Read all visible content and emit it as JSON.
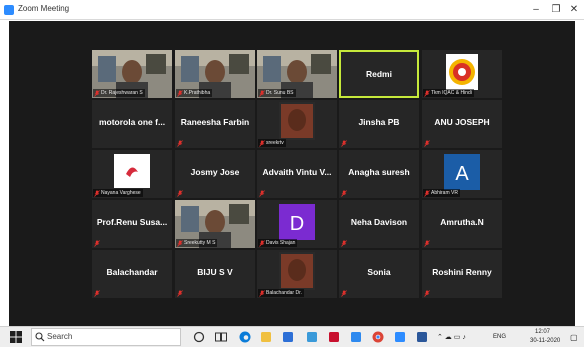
{
  "window": {
    "title": "Zoom Meeting"
  },
  "colors": {
    "zoom_blue": "#2D8CFF",
    "active_speaker": "#c6e93b",
    "tile_bg": "#262626",
    "gallery_bg": "#1a1a1a",
    "mic_muted": "#e0302c"
  },
  "participants": [
    {
      "name": "Dr. Rajeshwaran S",
      "type": "video",
      "muted": true
    },
    {
      "name": "K.Prathibha",
      "type": "video",
      "muted": true
    },
    {
      "name": "Dr. Sunu BS",
      "type": "video",
      "muted": true
    },
    {
      "name": "Redmi",
      "type": "name",
      "muted": false,
      "active": true
    },
    {
      "name": "Tkm IQAC & Hindi",
      "type": "logo",
      "muted": true
    },
    {
      "name": "motorola one f...",
      "type": "name",
      "muted": false
    },
    {
      "name": "Raneesha Farbin",
      "type": "name",
      "muted": true
    },
    {
      "name": "sreekrtv",
      "type": "photo",
      "muted": true
    },
    {
      "name": "Jinsha PB",
      "type": "name",
      "muted": true
    },
    {
      "name": "ANU JOSEPH",
      "type": "name",
      "muted": true
    },
    {
      "name": "Nayana Varghese",
      "type": "logo2",
      "muted": true
    },
    {
      "name": "Josmy Jose",
      "type": "name",
      "muted": true
    },
    {
      "name": "Advaith Vintu V...",
      "type": "name",
      "muted": true
    },
    {
      "name": "Anagha suresh",
      "type": "name",
      "muted": true
    },
    {
      "name": "Abhiram VR",
      "type": "avatar",
      "avatar_letter": "A",
      "avatar_color": "#1b5da7",
      "muted": true
    },
    {
      "name": "Prof.Renu Susa...",
      "type": "name",
      "muted": true
    },
    {
      "name": "Sreekutty M S",
      "type": "video",
      "muted": true
    },
    {
      "name": "Davis Shajan",
      "type": "avatar",
      "avatar_letter": "D",
      "avatar_color": "#7b2bd1",
      "muted": true
    },
    {
      "name": "Neha Davison",
      "type": "name",
      "muted": true
    },
    {
      "name": "Amrutha.N",
      "type": "name",
      "muted": true
    },
    {
      "name": "Balachandar",
      "type": "name",
      "muted": true
    },
    {
      "name": "BIJU S V",
      "type": "name",
      "muted": true
    },
    {
      "name": "Balachandar Dr.",
      "type": "photo",
      "muted": true
    },
    {
      "name": "Sonia",
      "type": "name",
      "muted": true
    },
    {
      "name": "Roshini Renny",
      "type": "name",
      "muted": true
    }
  ],
  "taskbar": {
    "search_placeholder": "Search",
    "apps": [
      {
        "icon": "cortana-icon",
        "color": "#333333"
      },
      {
        "icon": "task-view-icon",
        "color": "#333333"
      },
      {
        "icon": "edge-icon",
        "color": "#0a7cd8"
      },
      {
        "icon": "file-explorer-icon",
        "color": "#f0c040"
      },
      {
        "icon": "store-icon",
        "color": "#2d6fd6"
      },
      {
        "icon": "lock-app-icon",
        "color": "#3a9ad9"
      },
      {
        "icon": "mcafee-icon",
        "color": "#c8102e"
      },
      {
        "icon": "mail-icon",
        "color": "#2d89ef"
      },
      {
        "icon": "chrome-icon",
        "color": "#db4437"
      },
      {
        "icon": "zoom-icon",
        "color": "#2D8CFF"
      },
      {
        "icon": "word-icon",
        "color": "#2b579a"
      }
    ],
    "lang": "ENG",
    "time": "12:07",
    "date": "30-11-2020"
  }
}
